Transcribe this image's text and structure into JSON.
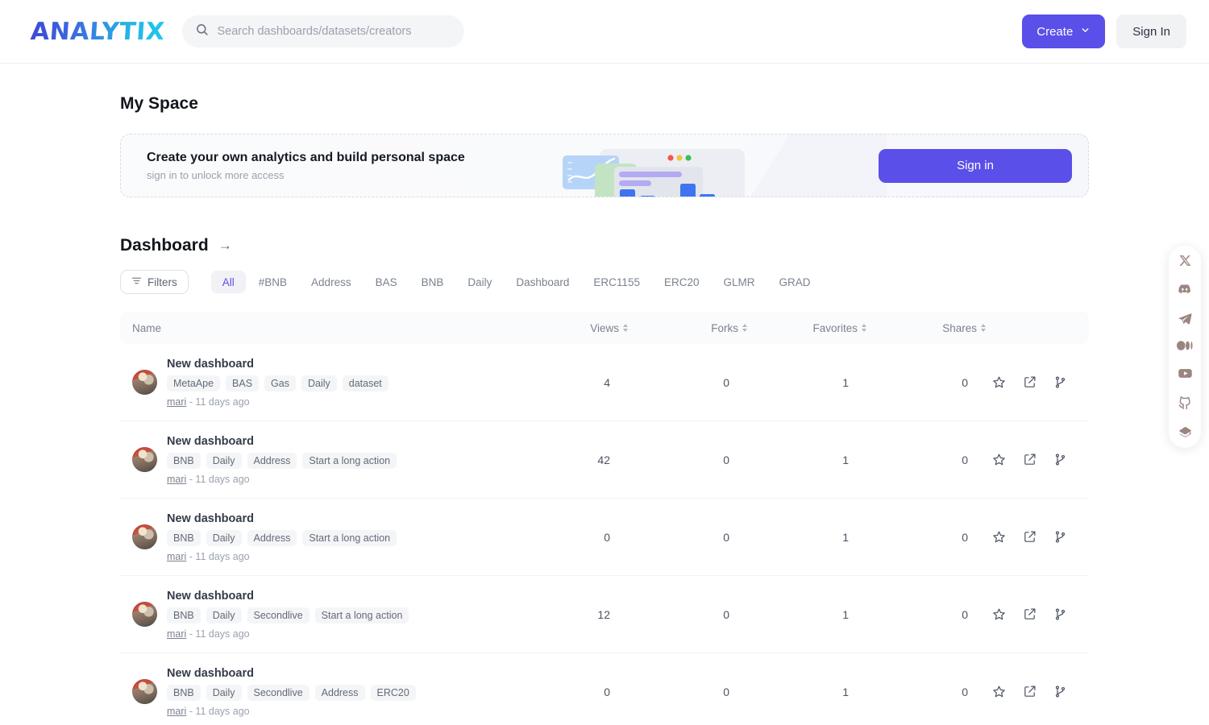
{
  "header": {
    "logo_text": "ANALYTIX",
    "search": {
      "placeholder": "Search dashboards/datasets/creators",
      "value": ""
    },
    "create_label": "Create",
    "signin_label": "Sign In"
  },
  "page": {
    "title": "My Space"
  },
  "promo": {
    "title": "Create your own analytics and build personal space",
    "subtitle": "sign in to unlock more access",
    "button_label": "Sign in"
  },
  "section": {
    "title": "Dashboard",
    "arrow": "→",
    "filters_label": "Filters",
    "tabs": [
      {
        "label": "All",
        "active": true
      },
      {
        "label": "#BNB",
        "active": false
      },
      {
        "label": "Address",
        "active": false
      },
      {
        "label": "BAS",
        "active": false
      },
      {
        "label": "BNB",
        "active": false
      },
      {
        "label": "Daily",
        "active": false
      },
      {
        "label": "Dashboard",
        "active": false
      },
      {
        "label": "ERC1155",
        "active": false
      },
      {
        "label": "ERC20",
        "active": false
      },
      {
        "label": "GLMR",
        "active": false
      },
      {
        "label": "GRAD",
        "active": false
      }
    ]
  },
  "table": {
    "columns": [
      "Name",
      "Views",
      "Forks",
      "Favorites",
      "Shares"
    ],
    "rows": [
      {
        "title": "New dashboard",
        "tags": [
          "MetaApe",
          "BAS",
          "Gas",
          "Daily",
          "dataset"
        ],
        "author": "mari",
        "time": "- 11 days ago",
        "views": "4",
        "forks": "0",
        "favorites": "1",
        "shares": "0"
      },
      {
        "title": "New dashboard",
        "tags": [
          "BNB",
          "Daily",
          "Address",
          "Start a long action"
        ],
        "author": "mari",
        "time": "- 11 days ago",
        "views": "42",
        "forks": "0",
        "favorites": "1",
        "shares": "0"
      },
      {
        "title": "New dashboard",
        "tags": [
          "BNB",
          "Daily",
          "Address",
          "Start a long action"
        ],
        "author": "mari",
        "time": "- 11 days ago",
        "views": "0",
        "forks": "0",
        "favorites": "1",
        "shares": "0"
      },
      {
        "title": "New dashboard",
        "tags": [
          "BNB",
          "Daily",
          "Secondlive",
          "Start a long action"
        ],
        "author": "mari",
        "time": "- 11 days ago",
        "views": "12",
        "forks": "0",
        "favorites": "1",
        "shares": "0"
      },
      {
        "title": "New dashboard",
        "tags": [
          "BNB",
          "Daily",
          "Secondlive",
          "Address",
          "ERC20"
        ],
        "author": "mari",
        "time": "- 11 days ago",
        "views": "0",
        "forks": "0",
        "favorites": "1",
        "shares": "0"
      }
    ]
  },
  "social": {
    "items": [
      "x-icon",
      "discord-icon",
      "telegram-icon",
      "medium-icon",
      "youtube-icon",
      "github-icon",
      "docs-book-icon"
    ]
  },
  "colors": {
    "accent": "#5b4fe9",
    "logo_from": "#3d49d6",
    "logo_to": "#1fc8ec",
    "chip_bg": "#f4f5f7",
    "social_icon": "#9b8580"
  }
}
